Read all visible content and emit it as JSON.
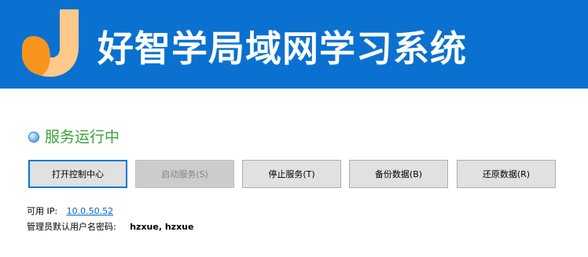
{
  "header": {
    "app_title": "好智学局域网学习系统",
    "logo_icon": "hzxue-logo-icon",
    "background_color": "#0a71d0"
  },
  "status": {
    "icon": "status-indicator-icon",
    "text": "服务运行中",
    "color": "#3ca03c"
  },
  "buttons": {
    "open_console": "打开控制中心",
    "start_service": "启动服务(S)",
    "stop_service": "停止服务(T)",
    "backup_data": "备份数据(B)",
    "restore_data": "还原数据(R)"
  },
  "info": {
    "ip_label": "可用 IP:",
    "ip_value": "10.0.50.52",
    "admin_label": "管理员默认用户名密码:",
    "admin_value": "hzxue, hzxue"
  }
}
